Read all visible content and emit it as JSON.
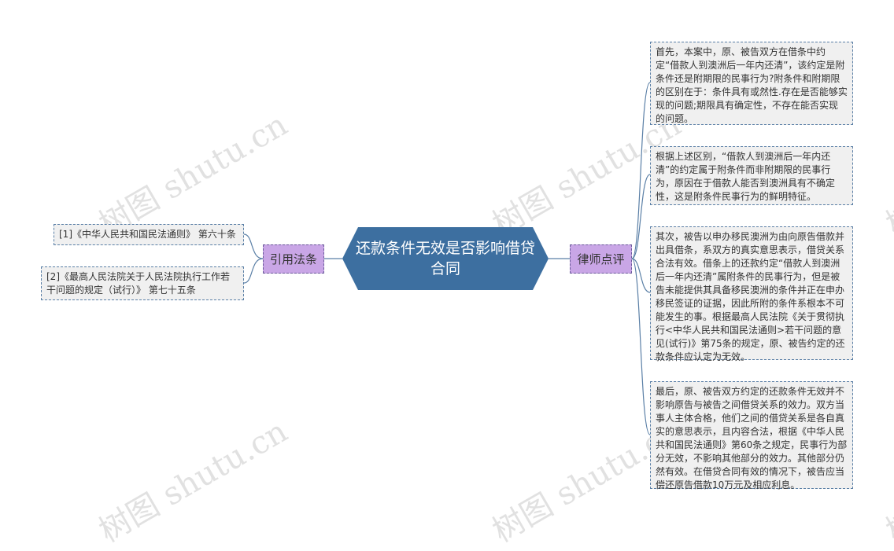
{
  "central": {
    "title": "还款条件无效是否影响借贷合同"
  },
  "left_branch": {
    "label": "引用法条",
    "items": [
      "[1]《中华人民共和国民法通则》 第六十条",
      "[2]《最高人民法院关于人民法院执行工作若干问题的规定（试行）》 第七十五条"
    ]
  },
  "right_branch": {
    "label": "律师点评",
    "items": [
      "首先，本案中，原、被告双方在借条中约定“借款人到澳洲后一年内还清”，该约定是附条件还是附期限的民事行为?附条件和附期限的区别在于：条件具有或然性.存在是否能够实现的问题;期限具有确定性，不存在能否实现的问题。",
      "根据上述区别，“借款人到澳洲后一年内还清”的约定属于附条件而非附期限的民事行为，原因在于借款人能否到澳洲具有不确定性，这是附条件民事行为的鲜明特征。",
      "其次，被告以申办移民澳洲为由向原告借款并出具借条，系双方的真实意思表示，借贷关系合法有效。借条上的还款约定“借款人到澳洲后一年内还清”属附条件的民事行为，但是被告未能提供其具备移民澳洲的条件并正在申办移民签证的证据，因此所附的条件系根本不可能发生的事。根据最高人民法院《关于贯彻执行<中华人民共和国民法通则>若干问题的意见(试行)》第75条的规定，原、被告约定的还款条件应认定为无效。",
      "最后，原、被告双方约定的还款条件无效并不影响原告与被告之间借贷关系的效力。双方当事人主体合格，他们之间的借贷关系是各自真实的意思表示，且内容合法，根据《中华人民共和国民法通则》第60条之规定，民事行为部分无效，不影响其他部分的效力。其他部分仍然有效。在借贷合同有效的情况下，被告应当偿还原告借款10万元及相应利息。"
    ]
  },
  "watermark": "树图 shutu.cn",
  "colors": {
    "central_fill": "#3d6fa0",
    "branch_fill": "#c9a6e6",
    "leaf_fill": "#f0f0f0",
    "connector": "#5a7fa6"
  }
}
